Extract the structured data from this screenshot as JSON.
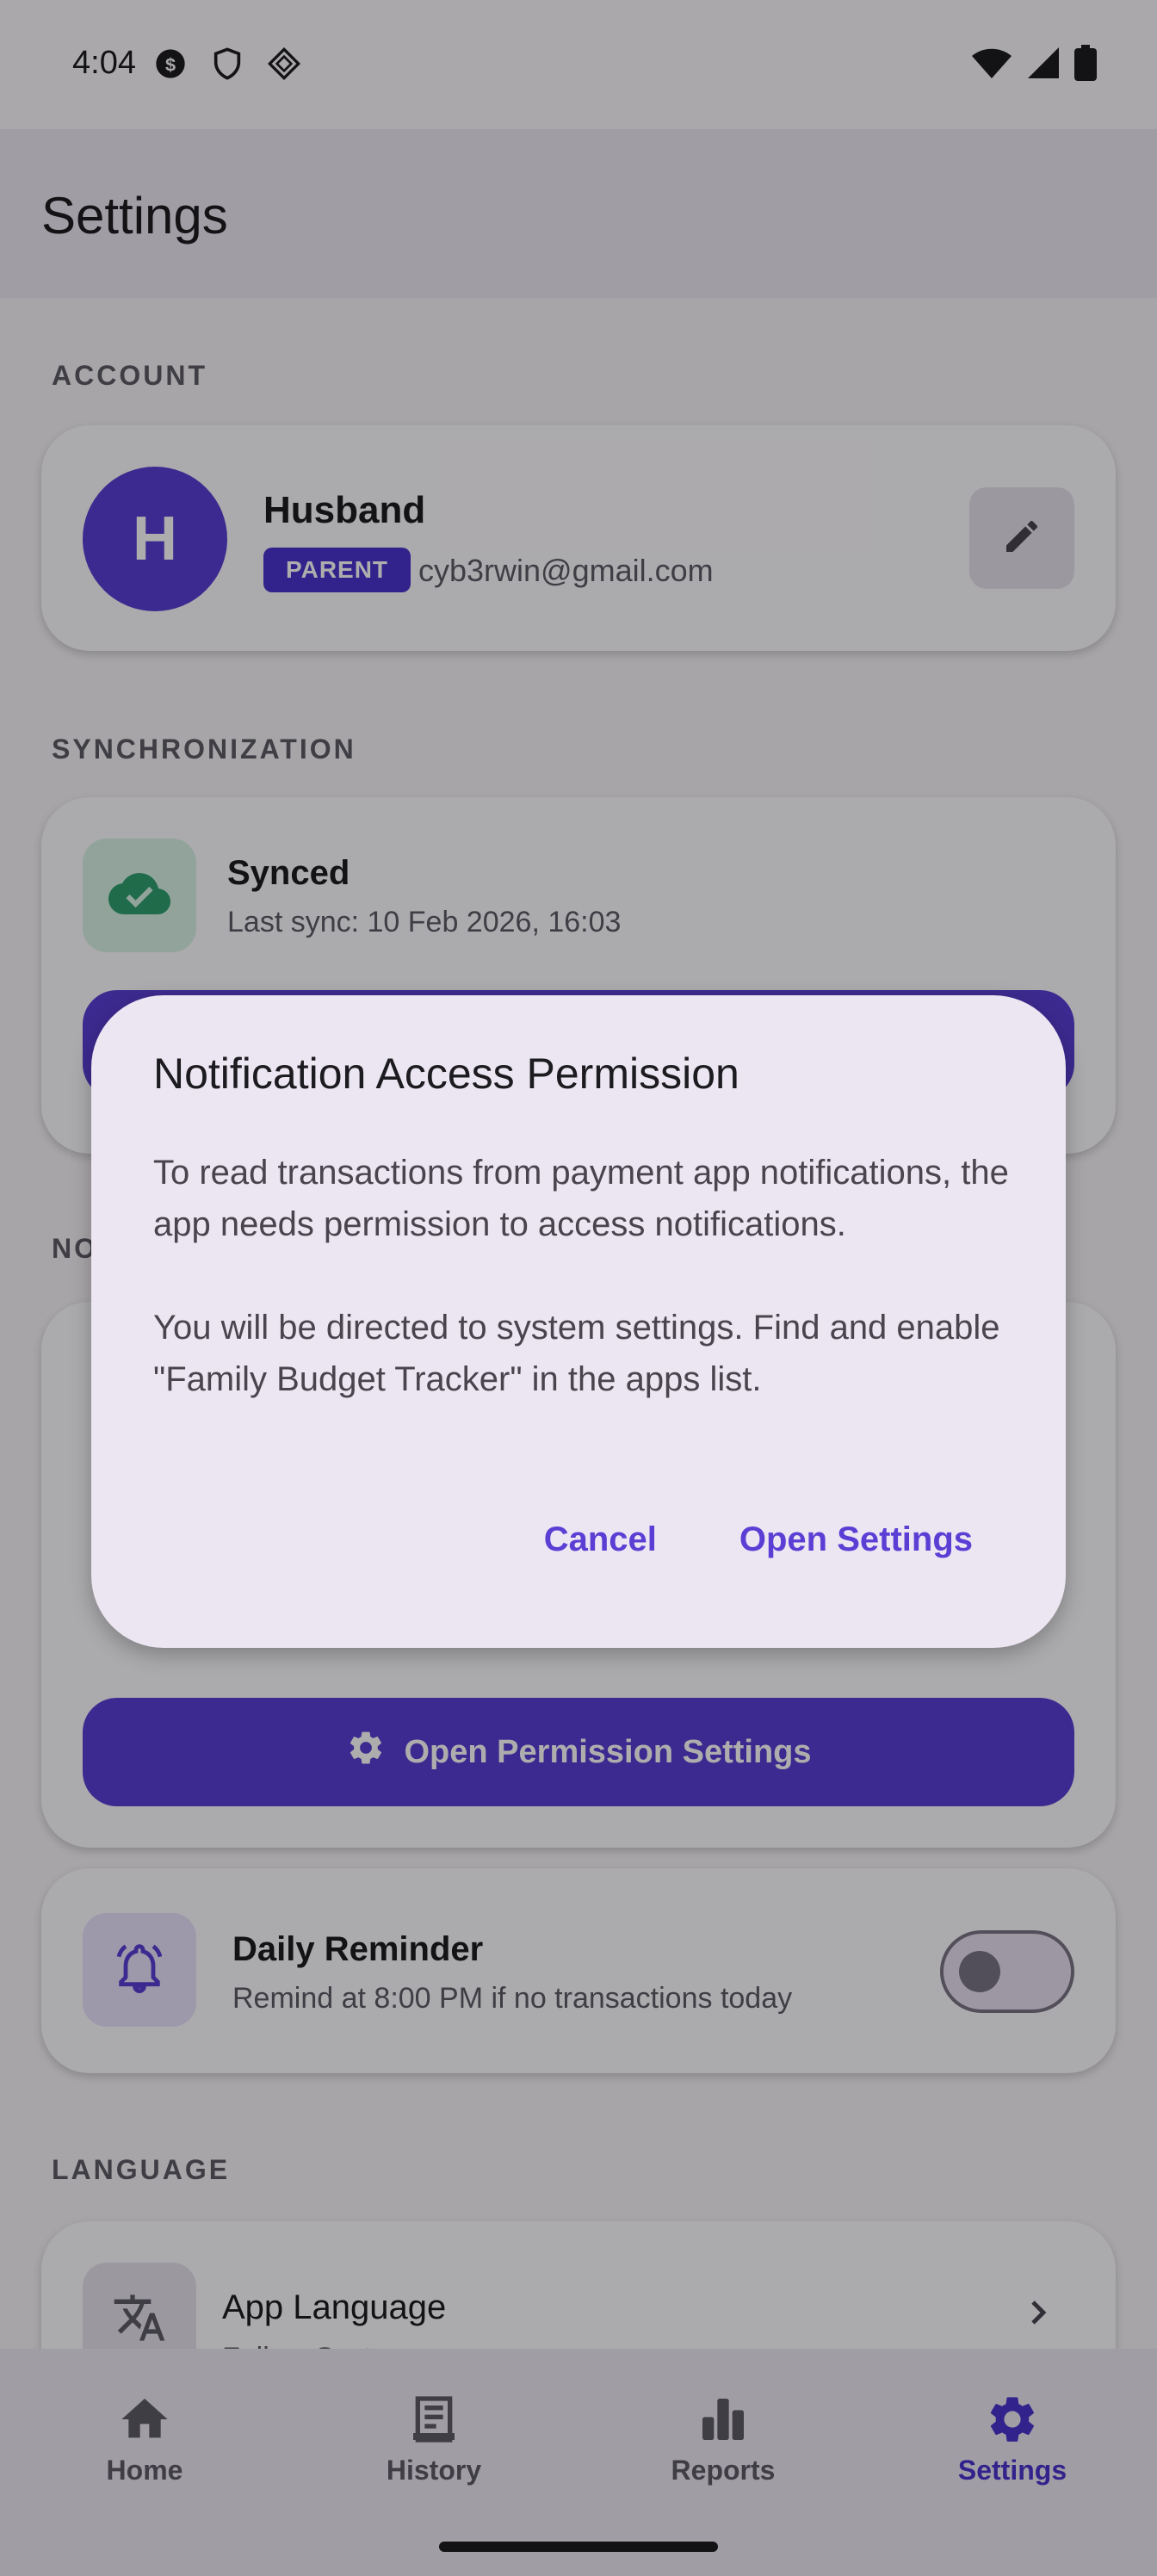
{
  "status_bar": {
    "time": "4:04",
    "icons_left": [
      "dollar-circle-icon",
      "shield-icon",
      "diamond-grid-icon"
    ],
    "icons_right": [
      "wifi-icon",
      "signal-icon",
      "battery-icon"
    ]
  },
  "app_bar": {
    "title": "Settings"
  },
  "account": {
    "section_label": "ACCOUNT",
    "avatar_initial": "H",
    "name": "Husband",
    "role": "PARENT",
    "email": "cyb3rwin@gmail.com"
  },
  "sync": {
    "section_label": "SYNCHRONIZATION",
    "status": "Synced",
    "last_sync": "Last sync: 10 Feb 2026, 16:03"
  },
  "notifications": {
    "section_label_partial": "NO",
    "open_permission_button": "Open Permission Settings"
  },
  "reminder": {
    "title": "Daily Reminder",
    "subtitle": "Remind at 8:00 PM if no transactions today",
    "enabled": false
  },
  "language": {
    "section_label": "LANGUAGE",
    "title": "App Language",
    "value": "Follow System"
  },
  "bottom_nav": {
    "items": [
      {
        "label": "Home",
        "icon": "home-icon",
        "active": false
      },
      {
        "label": "History",
        "icon": "receipt-icon",
        "active": false
      },
      {
        "label": "Reports",
        "icon": "bar-chart-icon",
        "active": false
      },
      {
        "label": "Settings",
        "icon": "gear-icon",
        "active": true
      }
    ]
  },
  "dialog": {
    "title": "Notification Access Permission",
    "body_1": "To read transactions from payment app notifications, the app needs permission to access notifications.",
    "body_2": "You will be directed to system settings. Find and enable \"Family Budget Tracker\" in the apps list.",
    "cancel": "Cancel",
    "confirm": "Open Settings"
  },
  "colors": {
    "primary": "#5b3fd4",
    "synced_green": "#2e9e6e"
  }
}
